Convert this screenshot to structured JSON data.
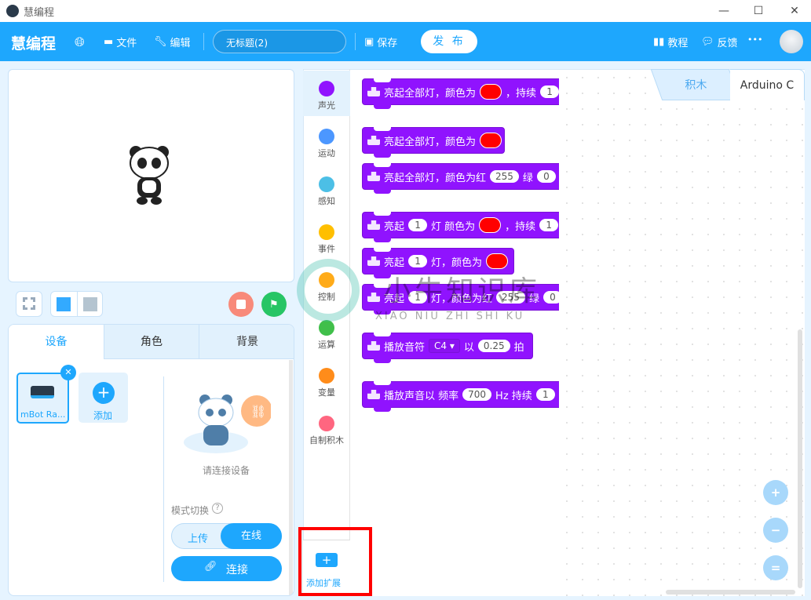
{
  "window": {
    "title": "慧编程"
  },
  "header": {
    "logo": "慧编程",
    "file": "文件",
    "edit": "编辑",
    "project_name": "无标题(2)",
    "save": "保存",
    "publish": "发 布",
    "tutorial": "教程",
    "feedback": "反馈",
    "more": "•••"
  },
  "stage_controls": {
    "stop_color": "#f88a7a",
    "go_color": "#27c565"
  },
  "sprite_panel": {
    "tabs": [
      "设备",
      "角色",
      "背景"
    ],
    "device_name": "mBot Ra...",
    "add_label": "添加",
    "connect_prompt": "请连接设备",
    "mode_label": "模式切换",
    "mode_options": [
      "上传",
      "在线"
    ],
    "mode_selected": "在线",
    "connect_button": "连接"
  },
  "categories": [
    {
      "label": "声光",
      "color": "#9013fe"
    },
    {
      "label": "运动",
      "color": "#4c97ff"
    },
    {
      "label": "感知",
      "color": "#4cbfe6"
    },
    {
      "label": "事件",
      "color": "#ffbf00"
    },
    {
      "label": "控制",
      "color": "#ffab19"
    },
    {
      "label": "运算",
      "color": "#40bf4a"
    },
    {
      "label": "变量",
      "color": "#ff8c1a"
    },
    {
      "label": "自制积木",
      "color": "#ff6680"
    }
  ],
  "add_extension": "添加扩展",
  "blocks": {
    "b1": {
      "t1": "亮起全部灯，颜色为",
      "t2": "，持续",
      "v1": "1"
    },
    "b2": {
      "t1": "亮起全部灯，颜色为"
    },
    "b3": {
      "t1": "亮起全部灯，颜色为红",
      "v1": "255",
      "t2": "绿",
      "v2": "0"
    },
    "b4": {
      "t1": "亮起",
      "v1": "1",
      "t2": "灯 颜色为",
      "t3": "，持续",
      "v2": "1"
    },
    "b5": {
      "t1": "亮起",
      "v1": "1",
      "t2": "灯，颜色为"
    },
    "b6": {
      "t1": "亮起",
      "v1": "1",
      "t2": "灯，颜色为红",
      "v2": "255",
      "t3": "绿",
      "v3": "0"
    },
    "b7": {
      "t1": "播放音符",
      "note": "C4 ▾",
      "t2": "以",
      "v1": "0.25",
      "t3": "拍"
    },
    "b8": {
      "t1": "播放声音以 频率",
      "v1": "700",
      "t2": "Hz 持续",
      "v2": "1"
    }
  },
  "workspace_tabs": [
    "积木",
    "Arduino C"
  ],
  "zoom_controls": [
    "+",
    "−",
    "="
  ],
  "watermark": {
    "cn": "小牛知识库",
    "en": "XIAO NIU ZHI SHI KU"
  }
}
